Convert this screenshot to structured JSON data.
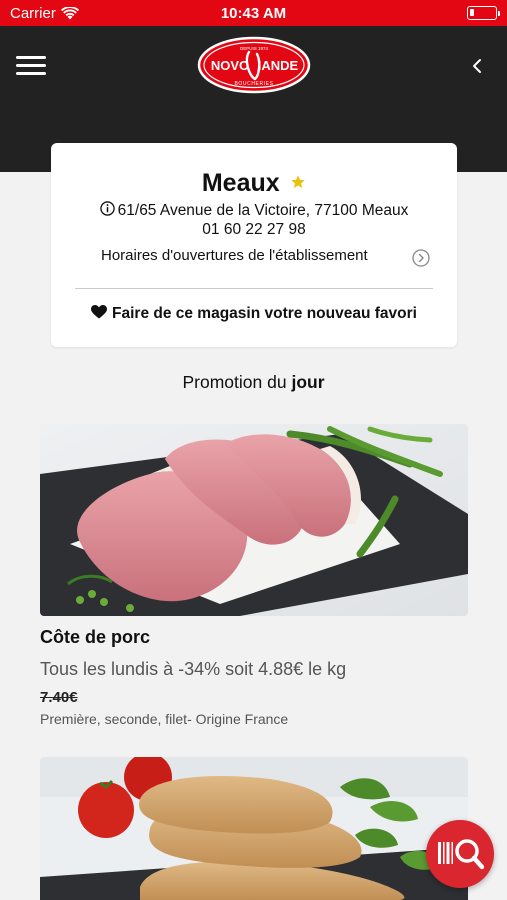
{
  "status_bar": {
    "carrier": "Carrier",
    "time": "10:43 AM",
    "battery_level": 0.15
  },
  "header": {
    "menu_icon": "hamburger-menu-icon",
    "back_icon": "chevron-left-icon",
    "logo": {
      "top_small": "DEPUIS 1974",
      "brand_left": "NOVO",
      "brand_right": "IANDE",
      "subtitle": "BOUCHERIES",
      "color": "#e30613"
    }
  },
  "store": {
    "name": "Meaux",
    "address": "61/65 Avenue de la Victoire, 77100 Meaux",
    "phone": "01 60 22 27 98",
    "hours_label": "Horaires d'ouvertures de l'établissement",
    "favorite_label": "Faire de ce magasin votre nouveau favori",
    "star_color": "#e8c20e"
  },
  "promotion": {
    "title_prefix": "Promotion du",
    "title_bold": "jour"
  },
  "products": [
    {
      "name": "Côte de porc",
      "promo": "Tous les lundis à -34% soit 4.88€ le kg",
      "old_price": "7.40€",
      "description": "Première, seconde, filet- Origine France"
    }
  ],
  "colors": {
    "brand_red": "#e30613",
    "header_bg": "#222222",
    "fab_red": "#d9262f"
  },
  "fab": {
    "icon": "barcode-search-icon"
  }
}
